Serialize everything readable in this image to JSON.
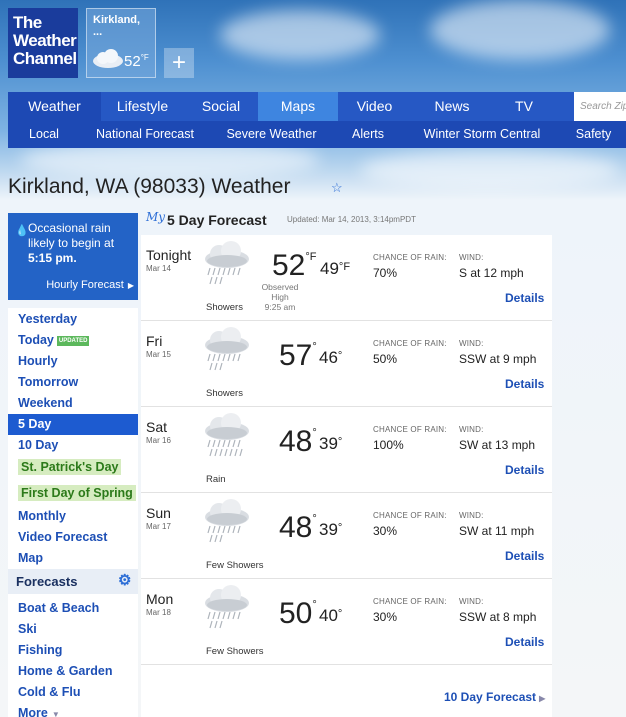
{
  "brand": {
    "logo_text": "The Weather Channel"
  },
  "saved_location": {
    "name": "Kirkland, ...",
    "temp": "52",
    "unit": "°F",
    "add_label": "+"
  },
  "nav_main": {
    "tabs": [
      "Weather",
      "Lifestyle",
      "Social",
      "Maps",
      "Video",
      "News",
      "TV"
    ],
    "active": "Weather"
  },
  "search": {
    "placeholder": "Search Zip"
  },
  "nav_sub": {
    "tabs": [
      "Local",
      "National Forecast",
      "Severe Weather",
      "Alerts",
      "Winter Storm Central",
      "Safety"
    ]
  },
  "page": {
    "title": "Kirkland, WA (98033) Weather"
  },
  "alert": {
    "message": "Occasional rain likely to begin at",
    "time": "5:15 pm.",
    "hourly_link": "Hourly Forecast"
  },
  "sidebar": {
    "items": [
      {
        "label": "Yesterday"
      },
      {
        "label": "Today",
        "badge": "UPDATED"
      },
      {
        "label": "Hourly"
      },
      {
        "label": "Tomorrow"
      },
      {
        "label": "Weekend"
      },
      {
        "label": "5 Day",
        "active": true
      },
      {
        "label": "10 Day"
      },
      {
        "label": "St. Patrick's Day",
        "highlight": true
      },
      {
        "label": "First Day of Spring",
        "highlight": true
      },
      {
        "label": "Monthly"
      },
      {
        "label": "Video Forecast"
      },
      {
        "label": "Map"
      }
    ],
    "forecasts_heading": "Forecasts",
    "forecast_items": [
      {
        "label": "Boat & Beach"
      },
      {
        "label": "Ski"
      },
      {
        "label": "Fishing"
      },
      {
        "label": "Home & Garden"
      },
      {
        "label": "Cold & Flu"
      },
      {
        "label": "More"
      }
    ]
  },
  "forecast": {
    "my_label": "My",
    "title": "5 Day Forecast",
    "updated": "Updated: Mar 14, 2013, 3:14pmPDT",
    "rain_label": "CHANCE OF RAIN:",
    "wind_label": "WIND:",
    "details_label": "Details",
    "observed": [
      "Observed",
      "High",
      "9:25 am"
    ],
    "days": [
      {
        "name": "Tonight",
        "date": "Mar 14",
        "condition": "Showers",
        "high": "52",
        "low": "49",
        "unit": "°F",
        "rain": "70%",
        "wind": "S at 12 mph"
      },
      {
        "name": "Fri",
        "date": "Mar 15",
        "condition": "Showers",
        "high": "57",
        "low": "46",
        "unit": "°",
        "rain": "50%",
        "wind": "SSW at 9 mph"
      },
      {
        "name": "Sat",
        "date": "Mar 16",
        "condition": "Rain",
        "high": "48",
        "low": "39",
        "unit": "°",
        "rain": "100%",
        "wind": "SW at 13 mph"
      },
      {
        "name": "Sun",
        "date": "Mar 17",
        "condition": "Few Showers",
        "high": "48",
        "low": "39",
        "unit": "°",
        "rain": "30%",
        "wind": "SW at 11 mph"
      },
      {
        "name": "Mon",
        "date": "Mar 18",
        "condition": "Few Showers",
        "high": "50",
        "low": "40",
        "unit": "°",
        "rain": "30%",
        "wind": "SSW at 8 mph"
      }
    ],
    "ten_day_link": "10 Day Forecast"
  }
}
